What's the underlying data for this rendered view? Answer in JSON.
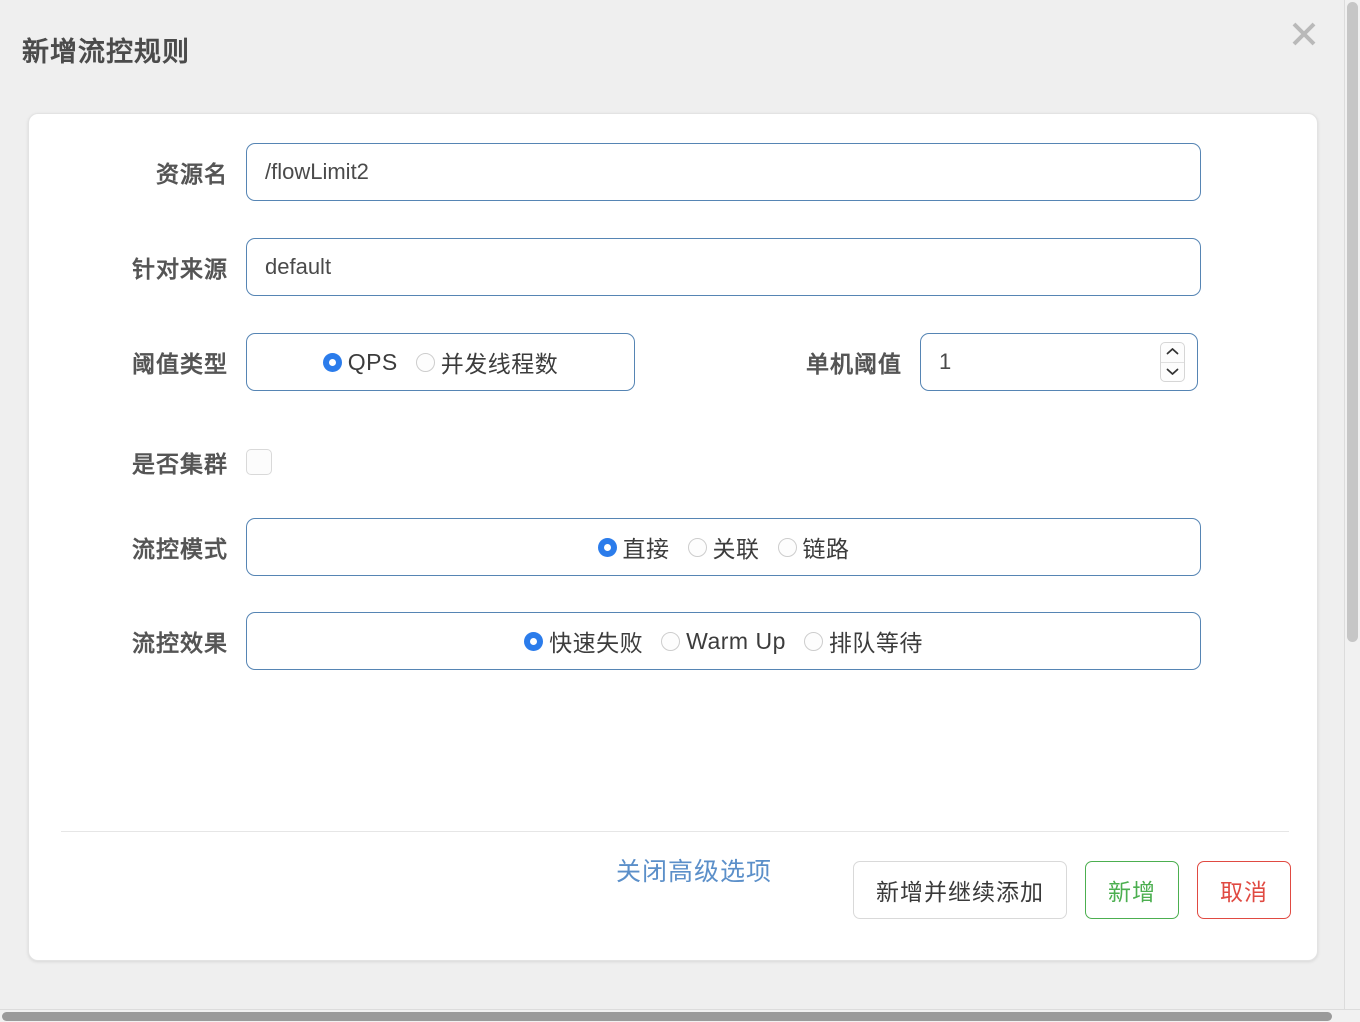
{
  "dialog": {
    "title": "新增流控规则",
    "close_icon": "close-icon"
  },
  "form": {
    "resource": {
      "label": "资源名",
      "value": "/flowLimit2",
      "placeholder": "资源名"
    },
    "origin": {
      "label": "针对来源",
      "value": "default",
      "placeholder": "default"
    },
    "threshold_type": {
      "label": "阈值类型",
      "options": [
        {
          "label": "QPS",
          "selected": true
        },
        {
          "label": "并发线程数",
          "selected": false
        }
      ]
    },
    "single_threshold": {
      "label": "单机阈值",
      "value": "1",
      "stepper_up_icon": "chevron-up-icon",
      "stepper_down_icon": "chevron-down-icon"
    },
    "is_cluster": {
      "label": "是否集群",
      "checked": false
    },
    "flow_mode": {
      "label": "流控模式",
      "options": [
        {
          "label": "直接",
          "selected": true
        },
        {
          "label": "关联",
          "selected": false
        },
        {
          "label": "链路",
          "selected": false
        }
      ]
    },
    "flow_effect": {
      "label": "流控效果",
      "options": [
        {
          "label": "快速失败",
          "selected": true
        },
        {
          "label": "Warm Up",
          "selected": false
        },
        {
          "label": "排队等待",
          "selected": false
        }
      ]
    },
    "advanced_toggle": "关闭高级选项"
  },
  "footer": {
    "add_and_continue_label": "新增并继续添加",
    "add_label": "新增",
    "cancel_label": "取消"
  },
  "colors": {
    "accent_border": "#5685b4",
    "radio_selected": "#2b7ceb",
    "link": "#5b8fc9",
    "success": "#4caf50",
    "danger": "#e04a42",
    "page_bg": "#efefef"
  }
}
